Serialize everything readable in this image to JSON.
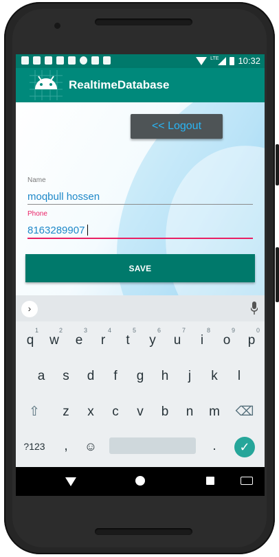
{
  "statusbar": {
    "time": "10:32",
    "network": "LTE",
    "icons": [
      "shield-icon",
      "gmail-icon",
      "sync-icon",
      "sync-icon",
      "photo-icon",
      "record-icon",
      "sd-card-icon",
      "cast-icon"
    ]
  },
  "appbar": {
    "title": "RealtimeDatabase",
    "icon": "android-icon"
  },
  "logout": {
    "label": "<< Logout"
  },
  "form": {
    "name_label": "Name",
    "name_value": "moqbull hossen",
    "phone_label": "Phone",
    "phone_value": "8163289907"
  },
  "save": {
    "label": "SAVE"
  },
  "keyboard": {
    "row1": [
      [
        "q",
        "1"
      ],
      [
        "w",
        "2"
      ],
      [
        "e",
        "3"
      ],
      [
        "r",
        "4"
      ],
      [
        "t",
        "5"
      ],
      [
        "y",
        "6"
      ],
      [
        "u",
        "7"
      ],
      [
        "i",
        "8"
      ],
      [
        "o",
        "9"
      ],
      [
        "p",
        "0"
      ]
    ],
    "row2": [
      "a",
      "s",
      "d",
      "f",
      "g",
      "h",
      "j",
      "k",
      "l"
    ],
    "row3": [
      "z",
      "x",
      "c",
      "v",
      "b",
      "n",
      "m"
    ],
    "symbols_label": "?123",
    "comma": ",",
    "period": ".",
    "emoji": "☺",
    "enter": "✓",
    "chevron": "›",
    "backspace": "⌫",
    "shift": "⇧"
  },
  "colors": {
    "primary": "#00897b",
    "primary_dark": "#00796b",
    "accent": "#e91e63",
    "link": "#29b6f6"
  }
}
